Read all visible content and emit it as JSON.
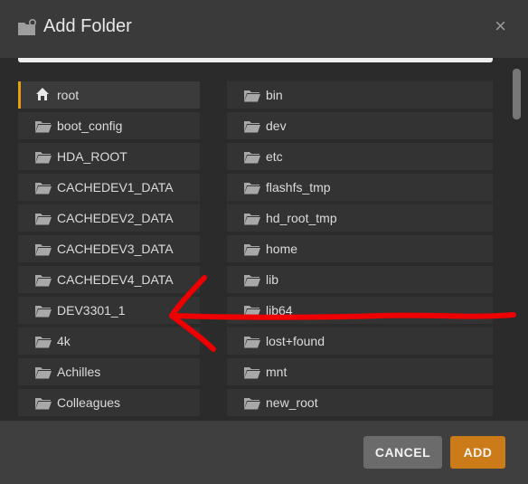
{
  "dialog": {
    "title": "Add Folder",
    "close_symbol": "×",
    "header_icon": "folder-settings-icon"
  },
  "folders": {
    "left": [
      {
        "label": "root",
        "icon": "home-icon",
        "selected": true
      },
      {
        "label": "boot_config",
        "icon": "folder-icon"
      },
      {
        "label": "HDA_ROOT",
        "icon": "folder-icon"
      },
      {
        "label": "CACHEDEV1_DATA",
        "icon": "folder-icon"
      },
      {
        "label": "CACHEDEV2_DATA",
        "icon": "folder-icon"
      },
      {
        "label": "CACHEDEV3_DATA",
        "icon": "folder-icon"
      },
      {
        "label": "CACHEDEV4_DATA",
        "icon": "folder-icon"
      },
      {
        "label": "DEV3301_1",
        "icon": "folder-icon"
      },
      {
        "label": "4k",
        "icon": "folder-icon"
      },
      {
        "label": "Achilles",
        "icon": "folder-icon"
      },
      {
        "label": "Colleagues",
        "icon": "folder-icon"
      }
    ],
    "right": [
      {
        "label": "bin",
        "icon": "folder-icon"
      },
      {
        "label": "dev",
        "icon": "folder-icon"
      },
      {
        "label": "etc",
        "icon": "folder-icon"
      },
      {
        "label": "flashfs_tmp",
        "icon": "folder-icon"
      },
      {
        "label": "hd_root_tmp",
        "icon": "folder-icon"
      },
      {
        "label": "home",
        "icon": "folder-icon"
      },
      {
        "label": "lib",
        "icon": "folder-icon"
      },
      {
        "label": "lib64",
        "icon": "folder-icon"
      },
      {
        "label": "lost+found",
        "icon": "folder-icon"
      },
      {
        "label": "mnt",
        "icon": "folder-icon"
      },
      {
        "label": "new_root",
        "icon": "folder-icon"
      }
    ]
  },
  "footer": {
    "cancel_label": "CANCEL",
    "add_label": "ADD"
  },
  "annotation": {
    "type": "hand-drawn-arrow",
    "color": "#ee0000",
    "points_to": "DEV3301_1"
  },
  "colors": {
    "accent": "#e5a00d",
    "add_button": "#cc7b19",
    "cancel_button": "#6b6b6b"
  }
}
